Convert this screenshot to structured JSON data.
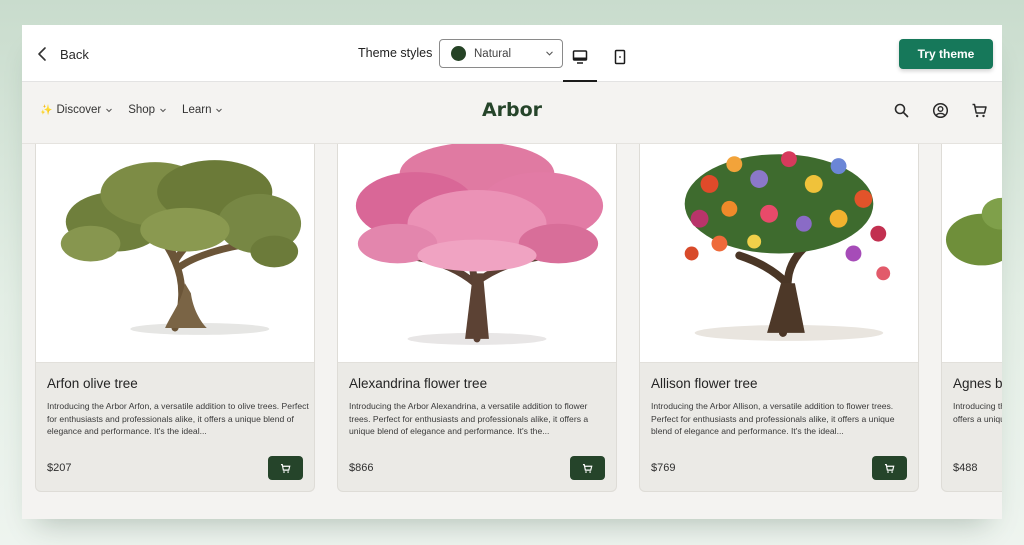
{
  "editor": {
    "back_label": "Back",
    "theme_styles_label": "Theme styles",
    "theme_style_selected": "Natural",
    "theme_style_swatch_color": "#264326",
    "try_theme_label": "Try theme",
    "try_theme_color": "#16785a",
    "active_device": "desktop"
  },
  "store": {
    "brand": "Arbor",
    "brand_color": "#25442a",
    "nav": [
      {
        "label": "Discover",
        "icon": "sparkle-icon"
      },
      {
        "label": "Shop"
      },
      {
        "label": "Learn"
      }
    ],
    "icons": [
      "search-icon",
      "account-icon",
      "cart-icon"
    ]
  },
  "products": [
    {
      "title": "Arfon olive tree",
      "description": "Introducing the Arbor Arfon, a versatile addition to olive trees. Perfect for enthusiasts and professionals alike, it offers a unique blend of elegance and performance. It's the ideal...",
      "price": "$207",
      "image": "olive-tree"
    },
    {
      "title": "Alexandrina flower tree",
      "description": "Introducing the Arbor Alexandrina, a versatile addition to flower trees. Perfect for enthusiasts and professionals alike, it offers a unique blend of elegance and performance. It's the...",
      "price": "$866",
      "image": "pink-blossom-tree"
    },
    {
      "title": "Allison flower tree",
      "description": "Introducing the Arbor Allison, a versatile addition to flower trees. Perfect for enthusiasts and professionals alike, it offers a unique blend of elegance and performance. It's the ideal...",
      "price": "$769",
      "image": "multicolor-flower-tree"
    },
    {
      "title": "Agnes b",
      "description": "Introducing the Arbor Agnes, a versatile addition to ... Perfect for ... it offers a unique blend of elegance and performance.",
      "price": "$488",
      "image": "green-tree"
    }
  ]
}
